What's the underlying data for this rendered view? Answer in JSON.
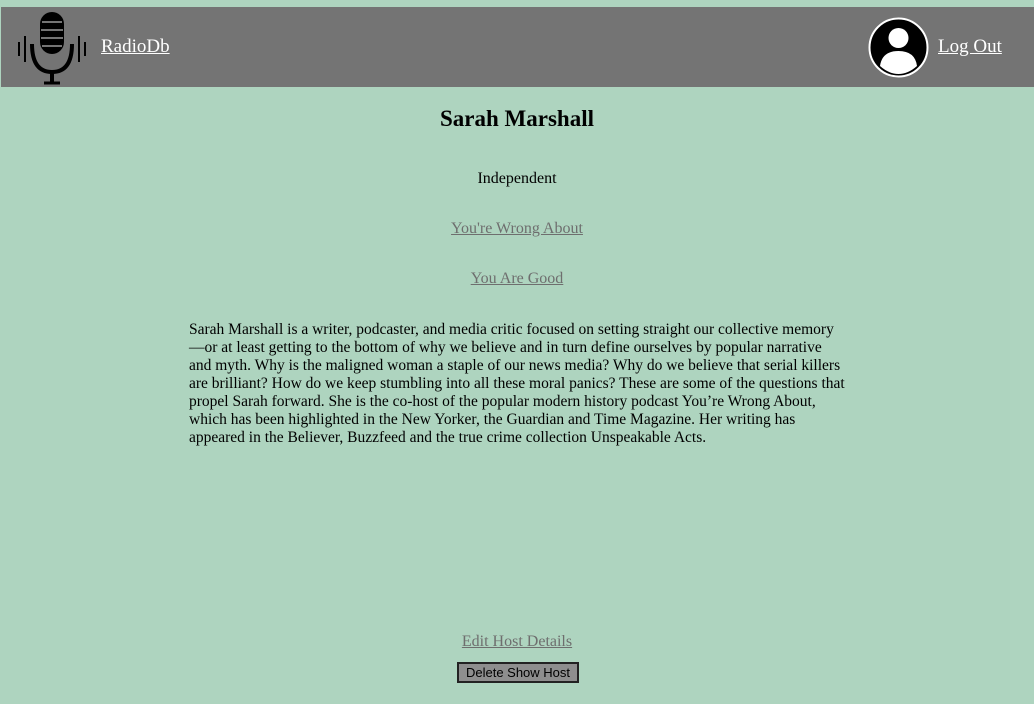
{
  "header": {
    "brand": "RadioDb",
    "logout": "Log Out",
    "logo_icon": "microphone-icon",
    "avatar_icon": "user-avatar-icon"
  },
  "host": {
    "name": "Sarah Marshall",
    "network": "Independent",
    "shows": [
      "You're Wrong About",
      "You Are Good"
    ],
    "bio": "Sarah Marshall is a writer, podcaster, and media critic focused on setting straight our collective memory—or at least getting to the bottom of why we believe and in turn define ourselves by popular narrative and myth. Why is the maligned woman a staple of our news media? Why do we believe that serial killers are brilliant? How do we keep stumbling into all these moral panics? These are some of the questions that propel Sarah forward. She is the co-host of the popular modern history podcast You’re Wrong About, which has been highlighted in the New Yorker, the Guardian and Time Magazine. Her writing has appeared in the Believer, Buzzfeed and the true crime collection Unspeakable Acts."
  },
  "actions": {
    "edit": "Edit Host Details",
    "delete": "Delete Show Host"
  },
  "colors": {
    "background": "#aed4bf",
    "navbar": "#747474",
    "link": "#6e6e6e",
    "button": "#8e8e8e"
  }
}
